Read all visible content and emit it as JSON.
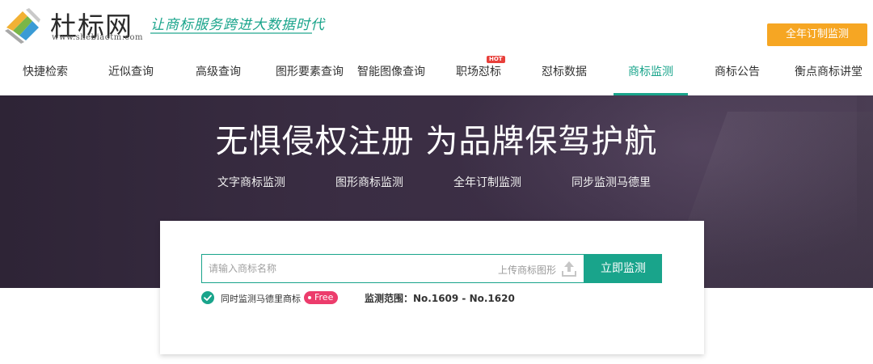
{
  "header": {
    "brand": "杜标网",
    "brand_url": "www.shebiaotm.com",
    "slogan": "让商标服务跨进大数据时代",
    "top_button": "全年订制监测"
  },
  "nav": {
    "items": [
      {
        "label": "快捷检索"
      },
      {
        "label": "近似查询"
      },
      {
        "label": "高级查询"
      },
      {
        "label": "图形要素查询"
      },
      {
        "label": "智能图像查询"
      },
      {
        "label": "职场怼标",
        "badge": "HOT"
      },
      {
        "label": "怼标数据"
      },
      {
        "label": "商标监测",
        "active": true
      },
      {
        "label": "商标公告"
      },
      {
        "label": "衡点商标讲堂"
      }
    ]
  },
  "banner": {
    "title": "无惧侵权注册 为品牌保驾护航",
    "links": [
      "文字商标监测",
      "图形商标监测",
      "全年订制监测",
      "同步监测马德里"
    ]
  },
  "search": {
    "placeholder": "请输入商标名称",
    "upload_label": "上传商标图形",
    "submit": "立即监测",
    "checkbox_label": "同时监测马德里商标",
    "free_badge": "Free",
    "scope": "监测范围：No.1609 - No.1620"
  },
  "colors": {
    "accent": "#19a48b",
    "orange": "#f6a623",
    "hot": "#e8403b",
    "free": "#ec3c6c",
    "banner_bg": "#3a2d43"
  }
}
